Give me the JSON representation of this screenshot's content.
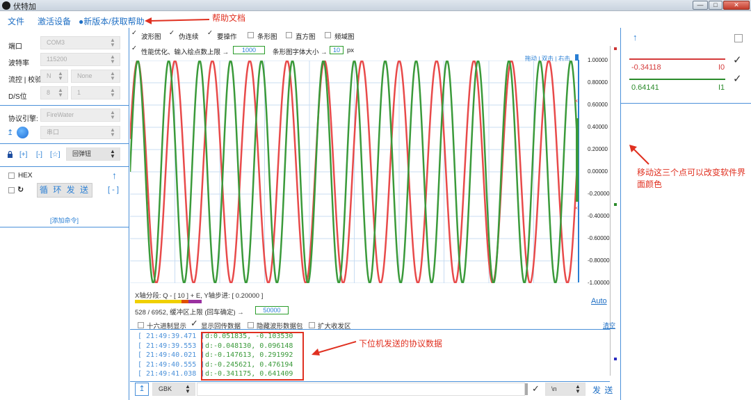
{
  "window": {
    "title": "伏特加"
  },
  "menu": {
    "file": "文件",
    "activate": "激活设备",
    "new_version": "●新版本/获取帮助"
  },
  "annotations": {
    "help_docs": "帮助文档",
    "move_dots": "移动这三个点可以改变软件界面颜色",
    "protocol_data": "下位机发送的协议数据"
  },
  "serial": {
    "port_label": "端口",
    "port_value": "COM3",
    "baud_label": "波特率",
    "baud_value": "115200",
    "flow_label": "流控 | 校验",
    "flow_value": "N",
    "parity_value": "None",
    "ds_label": "D/S位",
    "data_bits": "8",
    "stop_bits": "1",
    "protocol_label": "协议引擎:",
    "protocol_value": "FireWater",
    "channel_value": "串口",
    "upload_icon": "↥",
    "lock_icon": "lock",
    "add": "[+]",
    "remove": "[-]",
    "star": "[☆]",
    "popup_button": "回弹钮",
    "hex_label": "HEX",
    "cycle_send": "循 环 发 送",
    "minus": "[ - ]",
    "add_command": "[添加命令]",
    "cmd_arrow": "↑"
  },
  "options": {
    "waveform": "波形图",
    "pseudo": "伪连续",
    "ops": "要操作",
    "bar": "条形图",
    "histogram": "直方图",
    "spectrum": "频域图",
    "perf": "性能优化、输入绘点数上限 →",
    "perf_value": "1000",
    "font_size_label": "条形图字体大小 →",
    "font_size_value": "10",
    "px": "px",
    "drag_hint": "拖动 | 双击 | 右击"
  },
  "chart_data": {
    "type": "line",
    "ylim": [
      -1.0,
      1.0
    ],
    "yticks": [
      "1.00000",
      "0.80000",
      "0.60000",
      "0.40000",
      "0.20000",
      "0.00000",
      "-0.20000",
      "-0.40000",
      "-0.60000",
      "-0.80000",
      "-1.00000"
    ],
    "series": [
      {
        "name": "I0",
        "color": "#e84a4a",
        "cycles": 12.0,
        "phase": 0.3
      },
      {
        "name": "I1",
        "color": "#3a9a3a",
        "cycles": 14.5,
        "phase": 0.0
      }
    ]
  },
  "axis_info": {
    "x_div": "X轴分段:  Q - [ 10 ] + E,  Y轴步进:  [ 0.20000 ]",
    "buffer": "528 / 6952,  缓冲区上限 (回车确定)  →",
    "buffer_value": "50000",
    "auto": "Auto"
  },
  "display_opts": {
    "hex_display": "十六进制显示",
    "show_echo": "显示回传数据",
    "hide_wave": "隐藏波形数据包",
    "expand": "扩大收发区",
    "clear": "清空"
  },
  "log": [
    {
      "time": "[ 21:49:39.471 ]",
      "data": "d:0.051835, -0.103530"
    },
    {
      "time": "[ 21:49:39.553 ]",
      "data": "d:-0.048130, 0.096148"
    },
    {
      "time": "[ 21:49:40.021 ]",
      "data": "d:-0.147613, 0.291992"
    },
    {
      "time": "[ 21:49:40.555 ]",
      "data": "d:-0.245621, 0.476194"
    },
    {
      "time": "[ 21:49:41.038 ]",
      "data": "d:-0.341175, 0.641409"
    }
  ],
  "sendbar": {
    "upload": "↥",
    "encoding": "GBK",
    "newline": "\\n",
    "send": "发 送"
  },
  "channels": [
    {
      "value": "-0.34118",
      "name": "I0",
      "color": "#d43a3a"
    },
    {
      "value": "0.64141",
      "name": "I1",
      "color": "#2a8a2a"
    }
  ],
  "right_arrow": "↑",
  "colors": {
    "accent": "#4a90d9",
    "red": "#e84a4a",
    "green": "#3a9a3a",
    "annotation": "#e03020"
  }
}
